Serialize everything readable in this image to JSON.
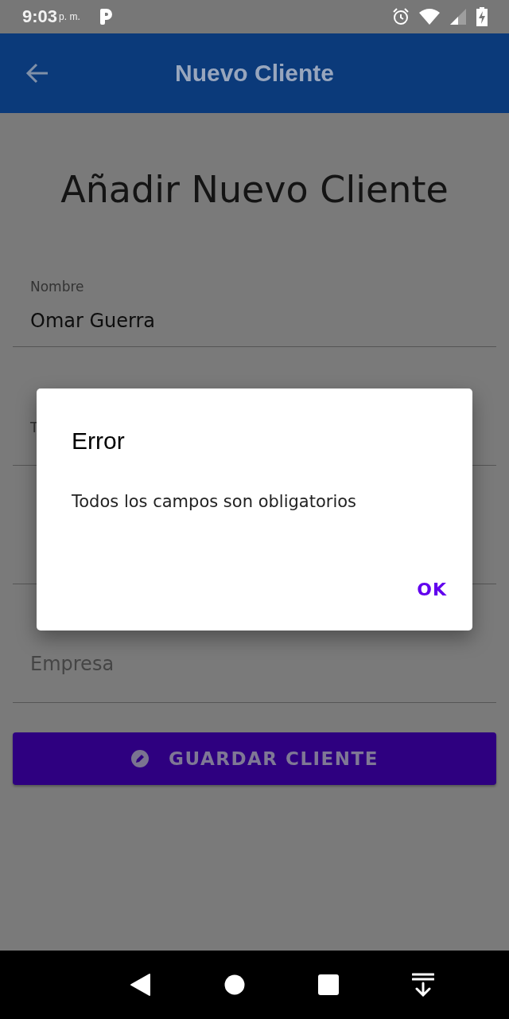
{
  "status_bar": {
    "time": "9:03",
    "period": "p. m."
  },
  "app_bar": {
    "title": "Nuevo Cliente"
  },
  "heading": "Añadir Nuevo Cliente",
  "fields": [
    {
      "kind": "text",
      "label": "Nombre",
      "value": "Omar Guerra"
    },
    {
      "kind": "text",
      "label": "T"
    },
    {
      "kind": "text"
    },
    {
      "kind": "text",
      "placeholder": "Empresa"
    }
  ],
  "save_button": "GUARDAR CLIENTE",
  "dialog": {
    "title": "Error",
    "message": "Todos los campos son obligatorios",
    "button": "OK"
  }
}
